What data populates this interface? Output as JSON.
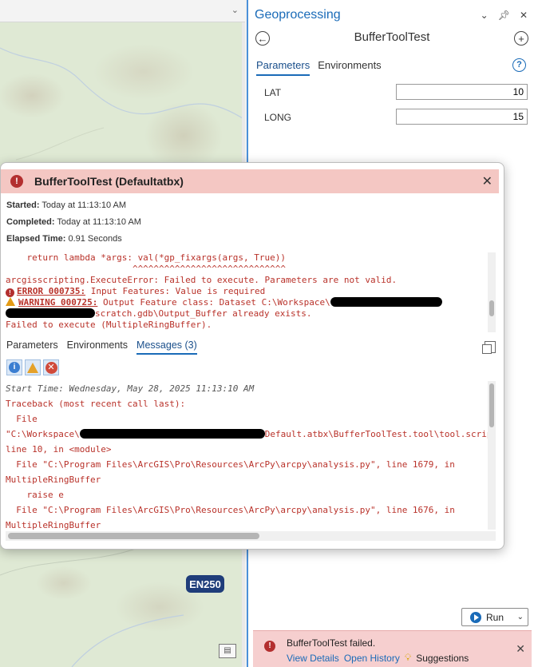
{
  "map": {
    "road_badge": "EN250"
  },
  "geoprocessing": {
    "pane_title": "Geoprocessing",
    "tool_title": "BufferToolTest",
    "tabs": [
      "Parameters",
      "Environments"
    ],
    "params": [
      {
        "label": "LAT",
        "value": "10"
      },
      {
        "label": "LONG",
        "value": "15"
      }
    ],
    "run_label": "Run",
    "fail": {
      "message": "BufferToolTest failed.",
      "view_details": "View Details",
      "open_history": "Open History",
      "suggestions": "Suggestions"
    }
  },
  "dialog": {
    "title": "BufferToolTest (Defaultatbx)",
    "started_label": "Started:",
    "started_value": "Today at 11:13:10 AM",
    "completed_label": "Completed:",
    "completed_value": "Today at 11:13:10 AM",
    "elapsed_label": "Elapsed Time:",
    "elapsed_value": "0.91 Seconds",
    "error_lines": {
      "l1": "    return lambda *args: val(*gp_fixargs(args, True))",
      "l2": "                        ^^^^^^^^^^^^^^^^^^^^^^^^^^^^^",
      "l3": "arcgisscripting.ExecuteError: Failed to execute. Parameters are not valid.",
      "err_label": "ERROR 000735:",
      "err_text": " Input Features: Value is required",
      "warn_label": "WARNING 000725:",
      "warn_text": " Output Feature class: Dataset C:\\Workspace\\",
      "l6_text": "scratch.gdb\\Output_Buffer already exists.",
      "l7": "Failed to execute (MultipleRingBuffer)."
    },
    "tabs": [
      "Parameters",
      "Environments",
      "Messages (3)"
    ],
    "messages": {
      "m1": "Start Time: Wednesday, May 28, 2025 11:13:10 AM",
      "m2": "Traceback (most recent call last):",
      "m3": "  File",
      "m4a": "\"C:\\Workspace\\",
      "m4b": "Default.atbx\\BufferToolTest.tool\\tool.script.execute.py\",",
      "m5": "line 10, in <module>",
      "m6": "  File \"C:\\Program Files\\ArcGIS\\Pro\\Resources\\ArcPy\\arcpy\\analysis.py\", line 1679, in",
      "m7": "MultipleRingBuffer",
      "m8": "    raise e",
      "m9": "  File \"C:\\Program Files\\ArcGIS\\Pro\\Resources\\ArcPy\\arcpy\\analysis.py\", line 1676, in",
      "m10": "MultipleRingBuffer"
    }
  }
}
